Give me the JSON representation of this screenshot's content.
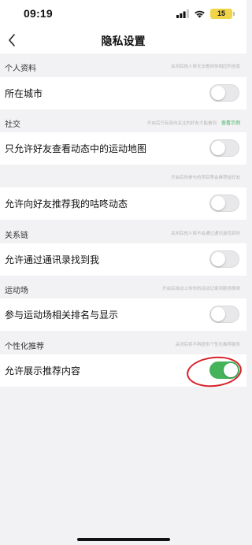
{
  "status_bar": {
    "time": "09:19",
    "battery": "15"
  },
  "header": {
    "title": "隐私设置"
  },
  "sections": [
    {
      "title": "个人资料",
      "hint": "关闭后他人将无法看到你相应的信息",
      "rows": [
        {
          "label": "所在城市",
          "enabled": false
        }
      ]
    },
    {
      "title": "社交",
      "hint": "开启后只有双向关注的好友才能看到",
      "hint_link": "查看示例",
      "rows": [
        {
          "label": "只允许好友查看动态中的运动地图",
          "enabled": false
        }
      ]
    },
    {
      "title": "",
      "hint": "开启后你参与的项目等会推荐给好友",
      "rows": [
        {
          "label": "允许向好友推荐我的咕咚动态",
          "enabled": false
        }
      ]
    },
    {
      "title": "关系链",
      "hint": "关闭后他人将不会通过通讯录找到你",
      "rows": [
        {
          "label": "允许通过通讯录找到我",
          "enabled": false
        }
      ]
    },
    {
      "title": "运动场",
      "hint": "开启后自动上传你的运动记录到跑场榜单",
      "rows": [
        {
          "label": "参与运动场相关排名与显示",
          "enabled": false
        }
      ]
    },
    {
      "title": "个性化推荐",
      "hint": "关闭后将不再提供个性化推荐服务",
      "rows": [
        {
          "label": "允许展示推荐内容",
          "enabled": true
        }
      ]
    }
  ],
  "colors": {
    "toggle_on": "#44b35a",
    "annotation": "#d8222a",
    "link": "#3fae62"
  }
}
